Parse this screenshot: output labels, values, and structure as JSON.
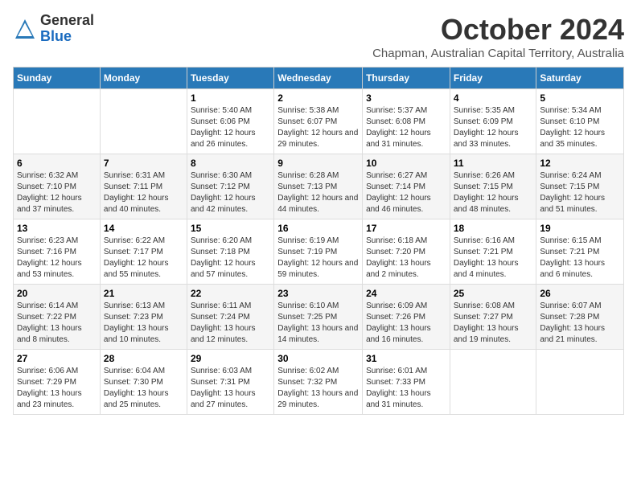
{
  "logo": {
    "general": "General",
    "blue": "Blue"
  },
  "title": "October 2024",
  "location": "Chapman, Australian Capital Territory, Australia",
  "days_of_week": [
    "Sunday",
    "Monday",
    "Tuesday",
    "Wednesday",
    "Thursday",
    "Friday",
    "Saturday"
  ],
  "weeks": [
    [
      {
        "day": "",
        "info": ""
      },
      {
        "day": "",
        "info": ""
      },
      {
        "day": "1",
        "info": "Sunrise: 5:40 AM\nSunset: 6:06 PM\nDaylight: 12 hours and 26 minutes."
      },
      {
        "day": "2",
        "info": "Sunrise: 5:38 AM\nSunset: 6:07 PM\nDaylight: 12 hours and 29 minutes."
      },
      {
        "day": "3",
        "info": "Sunrise: 5:37 AM\nSunset: 6:08 PM\nDaylight: 12 hours and 31 minutes."
      },
      {
        "day": "4",
        "info": "Sunrise: 5:35 AM\nSunset: 6:09 PM\nDaylight: 12 hours and 33 minutes."
      },
      {
        "day": "5",
        "info": "Sunrise: 5:34 AM\nSunset: 6:10 PM\nDaylight: 12 hours and 35 minutes."
      }
    ],
    [
      {
        "day": "6",
        "info": "Sunrise: 6:32 AM\nSunset: 7:10 PM\nDaylight: 12 hours and 37 minutes."
      },
      {
        "day": "7",
        "info": "Sunrise: 6:31 AM\nSunset: 7:11 PM\nDaylight: 12 hours and 40 minutes."
      },
      {
        "day": "8",
        "info": "Sunrise: 6:30 AM\nSunset: 7:12 PM\nDaylight: 12 hours and 42 minutes."
      },
      {
        "day": "9",
        "info": "Sunrise: 6:28 AM\nSunset: 7:13 PM\nDaylight: 12 hours and 44 minutes."
      },
      {
        "day": "10",
        "info": "Sunrise: 6:27 AM\nSunset: 7:14 PM\nDaylight: 12 hours and 46 minutes."
      },
      {
        "day": "11",
        "info": "Sunrise: 6:26 AM\nSunset: 7:15 PM\nDaylight: 12 hours and 48 minutes."
      },
      {
        "day": "12",
        "info": "Sunrise: 6:24 AM\nSunset: 7:15 PM\nDaylight: 12 hours and 51 minutes."
      }
    ],
    [
      {
        "day": "13",
        "info": "Sunrise: 6:23 AM\nSunset: 7:16 PM\nDaylight: 12 hours and 53 minutes."
      },
      {
        "day": "14",
        "info": "Sunrise: 6:22 AM\nSunset: 7:17 PM\nDaylight: 12 hours and 55 minutes."
      },
      {
        "day": "15",
        "info": "Sunrise: 6:20 AM\nSunset: 7:18 PM\nDaylight: 12 hours and 57 minutes."
      },
      {
        "day": "16",
        "info": "Sunrise: 6:19 AM\nSunset: 7:19 PM\nDaylight: 12 hours and 59 minutes."
      },
      {
        "day": "17",
        "info": "Sunrise: 6:18 AM\nSunset: 7:20 PM\nDaylight: 13 hours and 2 minutes."
      },
      {
        "day": "18",
        "info": "Sunrise: 6:16 AM\nSunset: 7:21 PM\nDaylight: 13 hours and 4 minutes."
      },
      {
        "day": "19",
        "info": "Sunrise: 6:15 AM\nSunset: 7:21 PM\nDaylight: 13 hours and 6 minutes."
      }
    ],
    [
      {
        "day": "20",
        "info": "Sunrise: 6:14 AM\nSunset: 7:22 PM\nDaylight: 13 hours and 8 minutes."
      },
      {
        "day": "21",
        "info": "Sunrise: 6:13 AM\nSunset: 7:23 PM\nDaylight: 13 hours and 10 minutes."
      },
      {
        "day": "22",
        "info": "Sunrise: 6:11 AM\nSunset: 7:24 PM\nDaylight: 13 hours and 12 minutes."
      },
      {
        "day": "23",
        "info": "Sunrise: 6:10 AM\nSunset: 7:25 PM\nDaylight: 13 hours and 14 minutes."
      },
      {
        "day": "24",
        "info": "Sunrise: 6:09 AM\nSunset: 7:26 PM\nDaylight: 13 hours and 16 minutes."
      },
      {
        "day": "25",
        "info": "Sunrise: 6:08 AM\nSunset: 7:27 PM\nDaylight: 13 hours and 19 minutes."
      },
      {
        "day": "26",
        "info": "Sunrise: 6:07 AM\nSunset: 7:28 PM\nDaylight: 13 hours and 21 minutes."
      }
    ],
    [
      {
        "day": "27",
        "info": "Sunrise: 6:06 AM\nSunset: 7:29 PM\nDaylight: 13 hours and 23 minutes."
      },
      {
        "day": "28",
        "info": "Sunrise: 6:04 AM\nSunset: 7:30 PM\nDaylight: 13 hours and 25 minutes."
      },
      {
        "day": "29",
        "info": "Sunrise: 6:03 AM\nSunset: 7:31 PM\nDaylight: 13 hours and 27 minutes."
      },
      {
        "day": "30",
        "info": "Sunrise: 6:02 AM\nSunset: 7:32 PM\nDaylight: 13 hours and 29 minutes."
      },
      {
        "day": "31",
        "info": "Sunrise: 6:01 AM\nSunset: 7:33 PM\nDaylight: 13 hours and 31 minutes."
      },
      {
        "day": "",
        "info": ""
      },
      {
        "day": "",
        "info": ""
      }
    ]
  ]
}
